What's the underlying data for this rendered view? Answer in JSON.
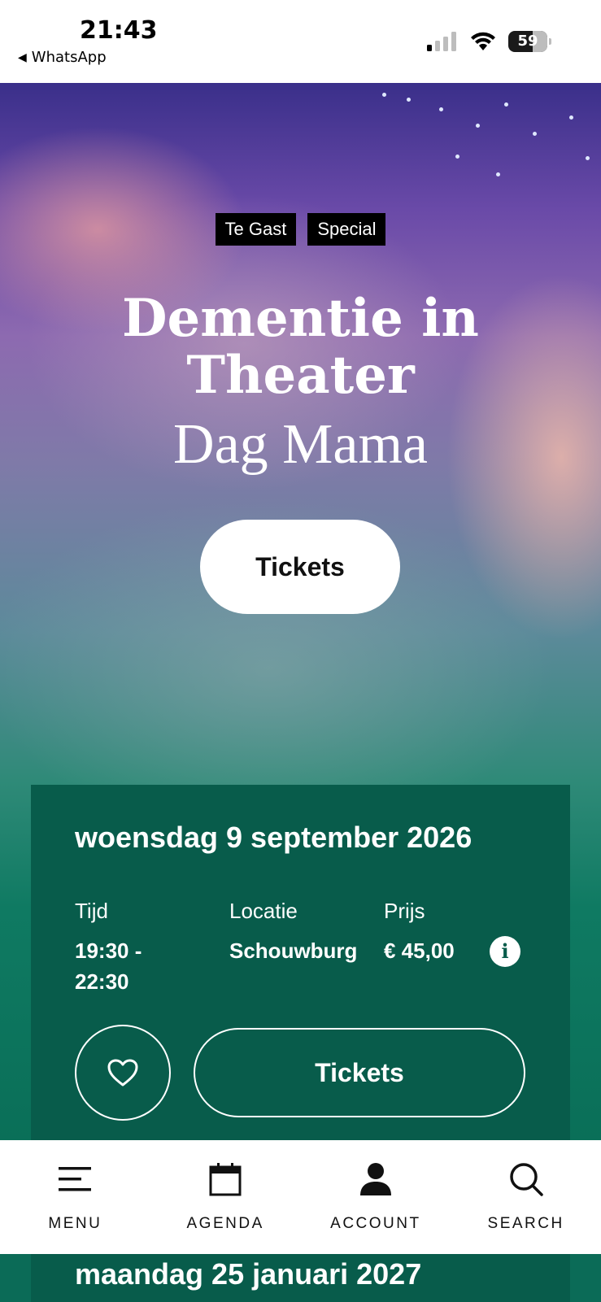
{
  "status_bar": {
    "time": "21:43",
    "back_label": "WhatsApp",
    "battery": "59"
  },
  "hero": {
    "tags": [
      "Te Gast",
      "Special"
    ],
    "title_line1": "Dementie in",
    "title_line2": "Theater",
    "subtitle": "Dag Mama",
    "tickets_label": "Tickets"
  },
  "event_card": {
    "date": "woensdag 9 september 2026",
    "time_label": "Tijd",
    "time_value": "19:30 - 22:30",
    "location_label": "Locatie",
    "location_value": "Schouwburg",
    "price_label": "Prijs",
    "price_value": "€ 45,00",
    "info_glyph": "i",
    "tickets_label": "Tickets"
  },
  "bottom_nav": {
    "menu": "MENU",
    "agenda": "AGENDA",
    "account": "ACCOUNT",
    "search": "SEARCH"
  },
  "next_card": {
    "date": "maandag 25 januari 2027"
  },
  "colors": {
    "card_green": "#085c4b",
    "tag_black": "#000000"
  }
}
